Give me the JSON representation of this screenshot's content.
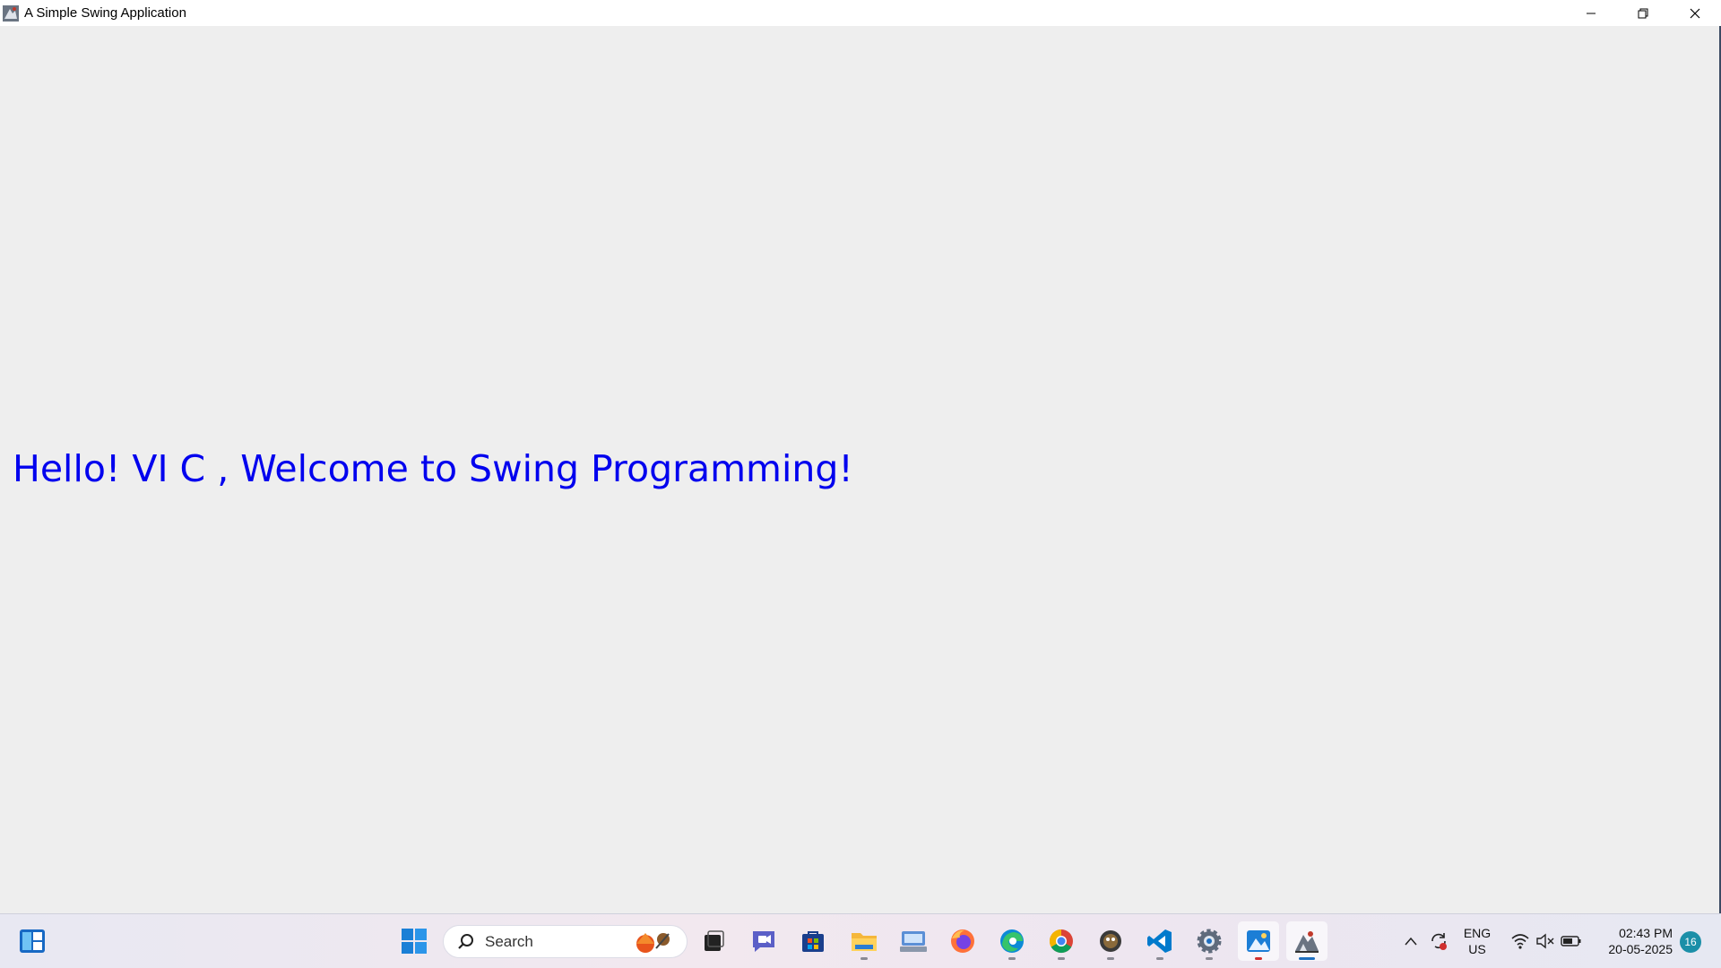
{
  "window": {
    "title": "A Simple Swing Application",
    "controls": [
      "minimize",
      "restore",
      "close"
    ]
  },
  "content": {
    "label": "Hello! VI C , Welcome to Swing Programming!",
    "label_color": "#0000ee",
    "background": "#eeeeee"
  },
  "taskbar": {
    "search_placeholder": "Search",
    "pinned_icons": [
      "widgets-icon",
      "windows-start-icon",
      "search-icon",
      "task-view-icon",
      "teams-chat-icon",
      "microsoft-store-icon",
      "file-explorer-icon",
      "keyboard-app-icon",
      "firefox-icon",
      "edge-icon",
      "chrome-icon",
      "app-icon",
      "vscode-icon",
      "settings-icon",
      "photos-icon",
      "java-app-icon"
    ],
    "tray": {
      "language_top": "ENG",
      "language_bottom": "US",
      "time": "02:43 PM",
      "date": "20-05-2025",
      "notification_count": "16"
    }
  }
}
